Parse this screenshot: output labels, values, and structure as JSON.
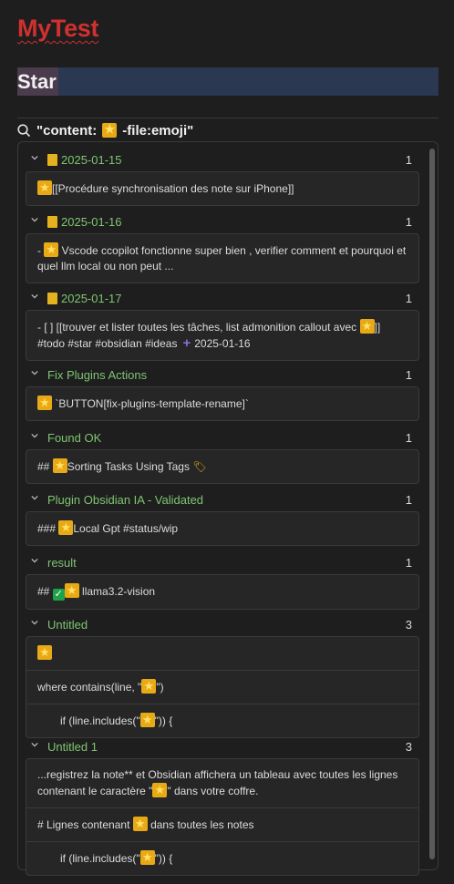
{
  "title": "MyTest",
  "heading": "Star",
  "query": {
    "text": "\"content:⭐ -file:emoji\"",
    "prefix": "\"content:",
    "suffix": "-file:emoji\""
  },
  "groups": [
    {
      "name": "2025-01-15",
      "count": "1",
      "daily": true,
      "matches": [
        {
          "pre": "",
          "post": "[[Procédure synchronisation des note sur iPhone]]"
        }
      ]
    },
    {
      "name": "2025-01-16",
      "count": "1",
      "daily": true,
      "matches": [
        {
          "pre": "- ",
          "post": " Vscode ccopilot fonctionne super bien , verifier comment et pourquoi et quel llm local ou non peut ..."
        }
      ]
    },
    {
      "name": "2025-01-17",
      "count": "1",
      "daily": true,
      "matches": [
        {
          "pre": "- [ ] [[trouver et lister toutes les tâches, list admonition callout avec ",
          "post": "]] #todo #star #obsidian  #ideas",
          "plus": "+",
          "date": "2025-01-16"
        }
      ]
    },
    {
      "name": "Fix Plugins Actions",
      "count": "1",
      "matches": [
        {
          "pre": "",
          "post": " `BUTTON[fix-plugins-template-rename]`"
        }
      ]
    },
    {
      "name": "Found OK",
      "count": "1",
      "matches": [
        {
          "pre": "## ",
          "post": "Sorting Tasks Using Tags ",
          "tag": "🏷"
        }
      ]
    },
    {
      "name": "Plugin Obsidian IA - Validated",
      "count": "1",
      "matches": [
        {
          "pre": "### ",
          "post": "Local Gpt #status/wip"
        }
      ]
    },
    {
      "name": "result",
      "count": "1",
      "matches": [
        {
          "pre": "## ",
          "check": "✓",
          "post": " llama3.2-vision"
        }
      ]
    },
    {
      "name": "Untitled",
      "count": "3",
      "matches": [
        {
          "pre": "",
          "post": ""
        },
        {
          "pre": "where contains(line, \"",
          "post": "\")"
        },
        {
          "pre": "if (line.includes(\"",
          "post": "\")) {",
          "indent": true
        }
      ]
    },
    {
      "name": "Untitled 1",
      "count": "3",
      "matches": [
        {
          "pre": "...registrez la note** et Obsidian affichera un tableau avec toutes les lignes contenant le caractère \"",
          "post": "\" dans votre coffre."
        },
        {
          "pre": "# Lignes contenant ",
          "post": " dans toutes les notes"
        },
        {
          "pre": "if (line.includes(\"",
          "post": "\")) {",
          "indent": true
        }
      ]
    }
  ]
}
